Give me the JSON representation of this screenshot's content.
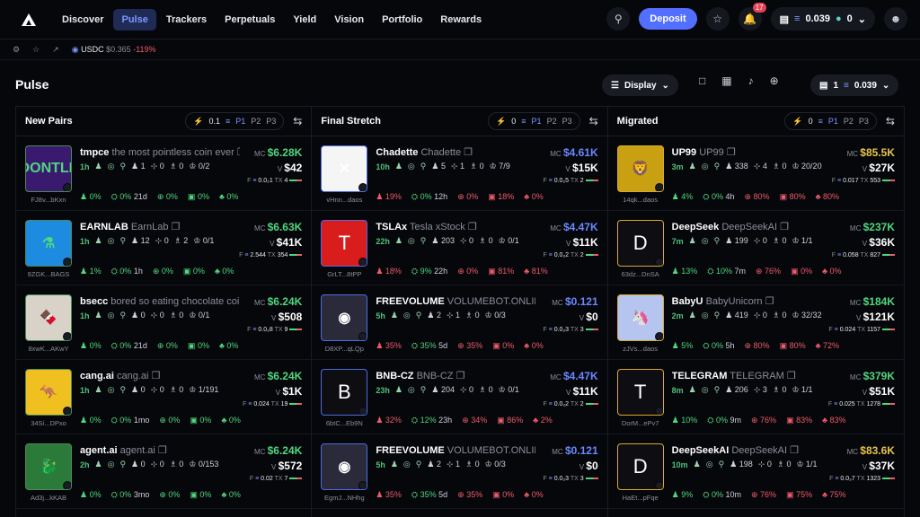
{
  "nav": {
    "items": [
      "Discover",
      "Pulse",
      "Trackers",
      "Perpetuals",
      "Yield",
      "Vision",
      "Portfolio",
      "Rewards"
    ],
    "active": "Pulse",
    "deposit": "Deposit",
    "notif_count": "17",
    "balance": "0.039",
    "points": "0"
  },
  "subbar": {
    "token": "USDC",
    "price": "$0.365",
    "change": "-119%"
  },
  "page": {
    "title": "Pulse",
    "display": "Display",
    "wallet_count": "1",
    "wallet_balance": "0.039"
  },
  "columns": [
    {
      "title": "New Pairs",
      "filter": "0.1",
      "p1": "P1",
      "p2": "P2",
      "p3": "P3"
    },
    {
      "title": "Final Stretch",
      "filter": "0",
      "p1": "P1",
      "p2": "P2",
      "p3": "P3"
    },
    {
      "title": "Migrated",
      "filter": "0",
      "p1": "P1",
      "p2": "P2",
      "p3": "P3"
    }
  ],
  "new_pairs": [
    {
      "ticker": "tmpce",
      "name": "the most pointless coin ever",
      "age": "1h",
      "addr": "FJ8v...bKxn",
      "thumb": "OONTLE",
      "holders": "1",
      "snipers": "0",
      "insiders": "0",
      "top": "0/2",
      "mc": "$6.28K",
      "v": "$42",
      "f": "0.0₂1",
      "tx": "4",
      "s1": "0%",
      "s2": "0%",
      "s2t": "21d",
      "s3": "0%",
      "s4": "0%",
      "s5": "0%"
    },
    {
      "ticker": "EARNLAB",
      "name": "EarnLab",
      "age": "1h",
      "addr": "9ZGK...BAGS",
      "thumb": "⚗",
      "holders": "12",
      "snipers": "0",
      "insiders": "2",
      "top": "0/1",
      "mc": "$6.63K",
      "v": "$41K",
      "f": "2.544",
      "tx": "354",
      "s1": "1%",
      "s2": "0%",
      "s2t": "1h",
      "s3": "0%",
      "s4": "0%",
      "s5": "0%"
    },
    {
      "ticker": "bsecc",
      "name": "bored so eating chocolate coin",
      "age": "1h",
      "addr": "8xwK...AKwY",
      "thumb": "🍫",
      "holders": "0",
      "snipers": "0",
      "insiders": "0",
      "top": "0/1",
      "mc": "$6.24K",
      "v": "$508",
      "f": "0.0₂8",
      "tx": "9",
      "s1": "0%",
      "s2": "0%",
      "s2t": "21d",
      "s3": "0%",
      "s4": "0%",
      "s5": "0%"
    },
    {
      "ticker": "cang.ai",
      "name": "cang.ai",
      "age": "1h",
      "addr": "34Si...DPxo",
      "thumb": "🦘",
      "holders": "0",
      "snipers": "0",
      "insiders": "0",
      "top": "1/191",
      "mc": "$6.24K",
      "v": "$1K",
      "f": "0.024",
      "tx": "19",
      "s1": "0%",
      "s2": "0%",
      "s2t": "1mo",
      "s3": "0%",
      "s4": "0%",
      "s5": "0%"
    },
    {
      "ticker": "agent.ai",
      "name": "agent.ai",
      "age": "2h",
      "addr": "Ad3j...kKAB",
      "thumb": "🐉",
      "holders": "0",
      "snipers": "0",
      "insiders": "0",
      "top": "0/153",
      "mc": "$6.24K",
      "v": "$572",
      "f": "0.02",
      "tx": "7",
      "s1": "0%",
      "s2": "0%",
      "s2t": "3mo",
      "s3": "0%",
      "s4": "0%",
      "s5": "0%"
    }
  ],
  "final_stretch": [
    {
      "ticker": "Chadette",
      "name": "Chadette",
      "age": "10h",
      "addr": "vHnn...daos",
      "thumb": "✕",
      "holders": "5",
      "snipers": "1",
      "insiders": "0",
      "top": "7/9",
      "mc": "$4.61K",
      "v": "$15K",
      "f": "0.0₂5",
      "tx": "2",
      "s1": "19%",
      "s2": "0%",
      "s2t": "12h",
      "s3": "0%",
      "s4": "18%",
      "s5": "0%"
    },
    {
      "ticker": "TSLAx",
      "name": "Tesla xStock",
      "age": "22h",
      "addr": "GrLT...8tPP",
      "thumb": "T",
      "holders": "203",
      "snipers": "0",
      "insiders": "0",
      "top": "0/1",
      "mc": "$4.47K",
      "v": "$11K",
      "f": "0.0₂2",
      "tx": "2",
      "s1": "18%",
      "s2": "9%",
      "s2t": "22h",
      "s3": "0%",
      "s4": "81%",
      "s5": "81%"
    },
    {
      "ticker": "FREEVOLUME",
      "name": "VOLUMEBOT.ONLINE F",
      "age": "5h",
      "addr": "D8XP...qLQp",
      "thumb": "◉",
      "holders": "2",
      "snipers": "1",
      "insiders": "0",
      "top": "0/3",
      "mc": "$0.121",
      "v": "$0",
      "f": "0.0₂3",
      "tx": "3",
      "s1": "35%",
      "s2": "35%",
      "s2t": "5d",
      "s3": "35%",
      "s4": "0%",
      "s5": "0%"
    },
    {
      "ticker": "BNB-CZ",
      "name": "BNB-CZ",
      "age": "23h",
      "addr": "6btC...Eb9N",
      "thumb": "B",
      "holders": "204",
      "snipers": "0",
      "insiders": "0",
      "top": "0/1",
      "mc": "$4.47K",
      "v": "$11K",
      "f": "0.0₂2",
      "tx": "2",
      "s1": "32%",
      "s2": "12%",
      "s2t": "23h",
      "s3": "34%",
      "s4": "86%",
      "s5": "2%"
    },
    {
      "ticker": "FREEVOLUME",
      "name": "VOLUMEBOT.ONLINE F",
      "age": "5h",
      "addr": "EgmJ...NHhg",
      "thumb": "◉",
      "holders": "2",
      "snipers": "1",
      "insiders": "0",
      "top": "0/3",
      "mc": "$0.121",
      "v": "$0",
      "f": "0.0₂3",
      "tx": "3",
      "s1": "35%",
      "s2": "35%",
      "s2t": "5d",
      "s3": "35%",
      "s4": "0%",
      "s5": "0%"
    }
  ],
  "migrated": [
    {
      "ticker": "UP99",
      "name": "UP99",
      "age": "3m",
      "addr": "14qk...daos",
      "thumb": "🦁",
      "holders": "338",
      "snipers": "4",
      "insiders": "0",
      "top": "20/20",
      "mc": "$85.5K",
      "v": "$27K",
      "f": "0.017",
      "tx": "553",
      "s1": "4%",
      "s2": "0%",
      "s2t": "4h",
      "s3": "80%",
      "s4": "80%",
      "s5": "80%"
    },
    {
      "ticker": "DeepSeek",
      "name": "DeepSeekAI",
      "age": "7m",
      "addr": "63dz...DnSA",
      "thumb": "D",
      "holders": "199",
      "snipers": "0",
      "insiders": "0",
      "top": "1/1",
      "mc": "$237K",
      "v": "$36K",
      "f": "0.058",
      "tx": "827",
      "s1": "13%",
      "s2": "10%",
      "s2t": "7m",
      "s3": "76%",
      "s4": "0%",
      "s5": "0%"
    },
    {
      "ticker": "BabyU",
      "name": "BabyUnicorn",
      "age": "2m",
      "addr": "zJVs...daos",
      "thumb": "🦄",
      "holders": "419",
      "snipers": "0",
      "insiders": "0",
      "top": "32/32",
      "mc": "$184K",
      "v": "$121K",
      "f": "0.024",
      "tx": "1157",
      "s1": "5%",
      "s2": "0%",
      "s2t": "5h",
      "s3": "80%",
      "s4": "80%",
      "s5": "72%"
    },
    {
      "ticker": "TELEGRAM",
      "name": "TELEGRAM",
      "age": "8m",
      "addr": "DorM...ePv7",
      "thumb": "T",
      "holders": "206",
      "snipers": "3",
      "insiders": "0",
      "top": "1/1",
      "mc": "$379K",
      "v": "$51K",
      "f": "0.025",
      "tx": "1278",
      "s1": "10%",
      "s2": "0%",
      "s2t": "9m",
      "s3": "76%",
      "s4": "83%",
      "s5": "83%"
    },
    {
      "ticker": "DeepSeekAI",
      "name": "DeepSeekAI",
      "age": "10m",
      "addr": "HaEt...pFqe",
      "thumb": "D",
      "holders": "198",
      "snipers": "0",
      "insiders": "0",
      "top": "1/1",
      "mc": "$83.6K",
      "v": "$37K",
      "f": "0.0₂7",
      "tx": "1323",
      "s1": "9%",
      "s2": "0%",
      "s2t": "10m",
      "s3": "76%",
      "s4": "75%",
      "s5": "75%"
    }
  ],
  "labels": {
    "mc": "MC",
    "v": "V",
    "f": "F",
    "tx": "TX"
  }
}
